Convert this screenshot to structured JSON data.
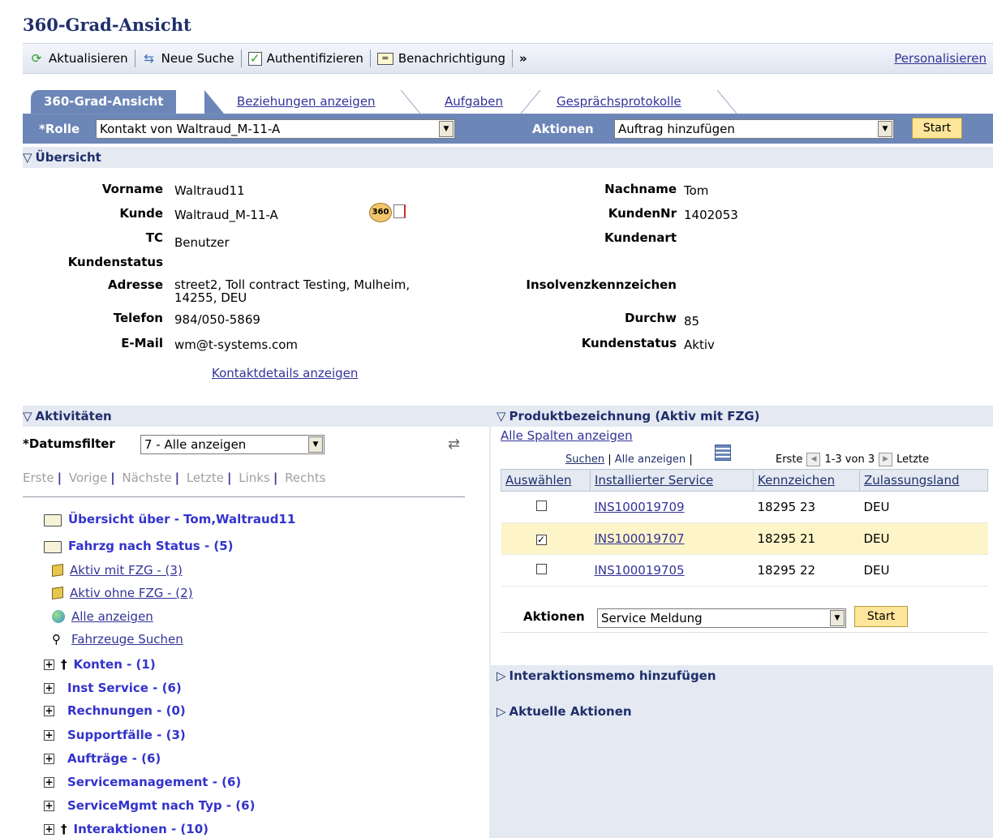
{
  "page_title": "360-Grad-Ansicht",
  "toolbar": {
    "refresh": "Aktualisieren",
    "new_search": "Neue Suche",
    "authenticate": "Authentifizieren",
    "notification": "Benachrichtigung",
    "more": "»",
    "personalize": "Personalisieren"
  },
  "tabs": [
    "360-Grad-Ansicht",
    "Beziehungen anzeigen",
    "Aufgaben",
    "Gesprächsprotokolle"
  ],
  "role_bar": {
    "role_label": "*Rolle",
    "role_value": "Kontakt von Waltraud_M-11-A",
    "actions_label": "Aktionen",
    "actions_value": "Auftrag hinzufügen",
    "start": "Start"
  },
  "overview": {
    "header": "Übersicht",
    "left": [
      {
        "label": "Vorname",
        "value": "Waltraud11"
      },
      {
        "label": "Kunde",
        "value": "Waltraud_M-11-A"
      },
      {
        "label": "TC",
        "value": "Benutzer"
      },
      {
        "label": "Kundenstatus",
        "value": ""
      },
      {
        "label": "Adresse",
        "value": "street2, Toll contract Testing, Mulheim,",
        "value2": "14255, DEU"
      },
      {
        "label": "Telefon",
        "value": "984/050-5869"
      },
      {
        "label": "E-Mail",
        "value": "wm@t-systems.com"
      }
    ],
    "right": [
      {
        "label": "Nachname",
        "value": "Tom"
      },
      {
        "label": "KundenNr",
        "value": "1402053"
      },
      {
        "label": "Kundenart",
        "value": ""
      },
      {
        "label": "Insolvenzkennzeichen",
        "value": ""
      },
      {
        "label": "Durchw",
        "value": "85"
      },
      {
        "label": "Kundenstatus",
        "value": "Aktiv"
      }
    ],
    "badge_360": "360",
    "contact_details_link": "Kontaktdetails anzeigen"
  },
  "activities": {
    "header": "Aktivitäten",
    "date_filter_label": "*Datumsfilter",
    "date_filter_value": "7 - Alle anzeigen",
    "nav": [
      "Erste",
      "Vorige",
      "Nächste",
      "Letzte",
      "Links",
      "Rechts"
    ],
    "tree": {
      "root": "Übersicht über - Tom,Waltraud11",
      "vehicles": "Fahrzg nach Status - (5)",
      "active_with": "Aktiv mit FZG - (3)",
      "active_without": "Aktiv ohne FZG - (2)",
      "show_all": "Alle anzeigen",
      "search_vehicles": "Fahrzeuge Suchen",
      "accounts": "Konten - (1)",
      "inst_service": "Inst Service - (6)",
      "invoices": "Rechnungen - (0)",
      "support": "Supportfälle - (3)",
      "orders": "Aufträge - (6)",
      "service_mgmt": "Servicemanagement - (6)",
      "service_mgmt_type": "ServiceMgmt nach Typ - (6)",
      "interactions": "Interaktionen - (10)"
    },
    "dagger": "†"
  },
  "products": {
    "header": "Produktbezeichnung (Aktiv mit FZG)",
    "show_all_columns": "Alle Spalten anzeigen",
    "search": "Suchen",
    "show_all": "Alle anzeigen",
    "first": "Erste",
    "range": "1-3 von 3",
    "last": "Letzte",
    "columns": [
      "Auswählen",
      "Installierter Service",
      "Kennzeichen",
      "Zulassungsland"
    ],
    "rows": [
      {
        "checked": "",
        "service": "INS100019709",
        "plate": "18295 23",
        "country": "DEU"
      },
      {
        "checked": "✓",
        "service": "INS100019707",
        "plate": "18295 21",
        "country": "DEU"
      },
      {
        "checked": "",
        "service": "INS100019705",
        "plate": "18295 22",
        "country": "DEU"
      }
    ],
    "actions_label": "Aktionen",
    "actions_value": "Service Meldung",
    "start": "Start"
  },
  "memo_header": "Interaktionsmemo hinzufügen",
  "current_actions_header": "Aktuelle Aktionen",
  "colors": {
    "accent": "#6c86b8",
    "section_bg": "#e4e9f2",
    "link": "#333399",
    "selected_row": "#fdf4c8",
    "button": "#fde59a"
  }
}
